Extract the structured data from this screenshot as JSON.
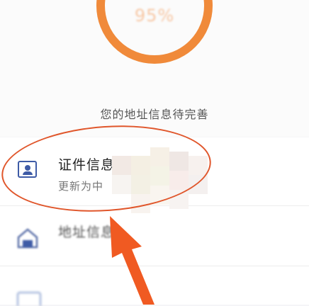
{
  "progress": {
    "percent_label": "95%",
    "caption": "",
    "value": 0.95
  },
  "hint": "您的地址信息待完善",
  "items": [
    {
      "title": "证件信息",
      "subtitle": "更新为中",
      "icon": "id-card-icon"
    },
    {
      "title": "地址信息",
      "icon": "house-icon"
    },
    {
      "title": "",
      "icon": "card-icon"
    }
  ],
  "annotation": {
    "ellipse_color": "#e0562b",
    "arrow_color": "#f05a22"
  },
  "colors": {
    "accent": "#f08a3a",
    "icon_blue": "#3e5ba6"
  }
}
